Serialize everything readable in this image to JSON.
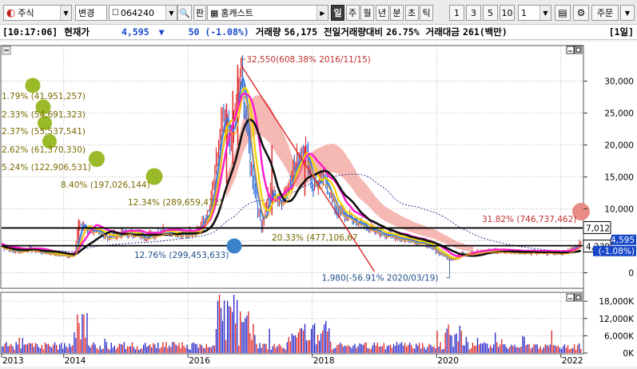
{
  "toolbar": {
    "market_type": "주식",
    "change_label": "변경",
    "stock_code": "064240",
    "chart_label": "판",
    "stock_name": "홈캐스트",
    "periods": [
      "일",
      "주",
      "월",
      "년",
      "분",
      "초",
      "틱"
    ],
    "active_period": "일",
    "intervals": [
      "1",
      "3",
      "5",
      "10"
    ],
    "interval_value": "1",
    "order_label": "주문"
  },
  "quote": {
    "time": "[10:17:06]",
    "price_label": "현재가",
    "price": "4,595",
    "change_arrow": "▼",
    "change": "50 (-1.08%)",
    "volume_label": "거래량",
    "volume": "56,175",
    "prev_volume_label": "전일거래량대비",
    "prev_volume_ratio": "26.75%",
    "amount_label": "거래대금",
    "amount": "261(백만)",
    "period_tag": "[1일]"
  },
  "annotations": {
    "peak": "32,550(608.38% 2016/11/15)",
    "low": "1,980(-56.91% 2020/03/19)",
    "vp": [
      {
        "text": "1.79% (41,951,257)",
        "color": "#7a6a00"
      },
      {
        "text": "2.33% (54,691,323)",
        "color": "#7a6a00"
      },
      {
        "text": "2.37% (55,537,541)",
        "color": "#7a6a00"
      },
      {
        "text": "2.62% (61,370,330)",
        "color": "#7a6a00"
      },
      {
        "text": "5.24% (122,906,531)",
        "color": "#7a6a00"
      },
      {
        "text": "8.40% (197,026,144)",
        "color": "#7a6a00"
      },
      {
        "text": "12.34% (289,659,412)",
        "color": "#7a6a00"
      },
      {
        "text": "12.76% (299,453,633)",
        "color": "#1f4e8a"
      },
      {
        "text": "20.33% (477,106,67",
        "color": "#7a6a00"
      },
      {
        "text": "31.82% (746,737,462)",
        "color": "#c03030"
      }
    ],
    "box_high": "7,012",
    "box_low": "4,239",
    "current_price": "4,595",
    "current_change": "(-1.08%)"
  },
  "price_axis": [
    "30,000",
    "25,000",
    "20,000",
    "15,000",
    "10,000",
    "5,000",
    "0"
  ],
  "volume_axis": [
    "18,000K",
    "12,000K",
    "6,000K",
    "0K"
  ],
  "x_axis": [
    "2013",
    "2014",
    "2016",
    "2018",
    "2020",
    "2022"
  ],
  "colors": {
    "candle_up": "#e02020",
    "candle_down": "#1f5fd8",
    "ma_black": "#111111",
    "ma_yellow": "#f2d200",
    "ma_magenta": "#ff19cc",
    "ma_blue": "#3a7ee0",
    "trendline": "#d81818",
    "vp_ball": "#9aba2a",
    "cloud": "#f3a09a"
  },
  "chart_data": {
    "type": "line",
    "x": [
      "2013",
      "2014-01",
      "2014-06",
      "2015-06",
      "2016-06",
      "2016-11-15",
      "2017-06",
      "2018-01",
      "2018-06",
      "2019-01",
      "2020-03-19",
      "2021-01",
      "2022-01"
    ],
    "series": [
      {
        "values": [
          4200,
          3200,
          7600,
          6600,
          11000,
          32550,
          12500,
          14500,
          9500,
          5500,
          1980,
          3200,
          4595
        ]
      }
    ],
    "ylim": [
      0,
      33000
    ],
    "volume_ylim": [
      0,
      20000
    ]
  }
}
